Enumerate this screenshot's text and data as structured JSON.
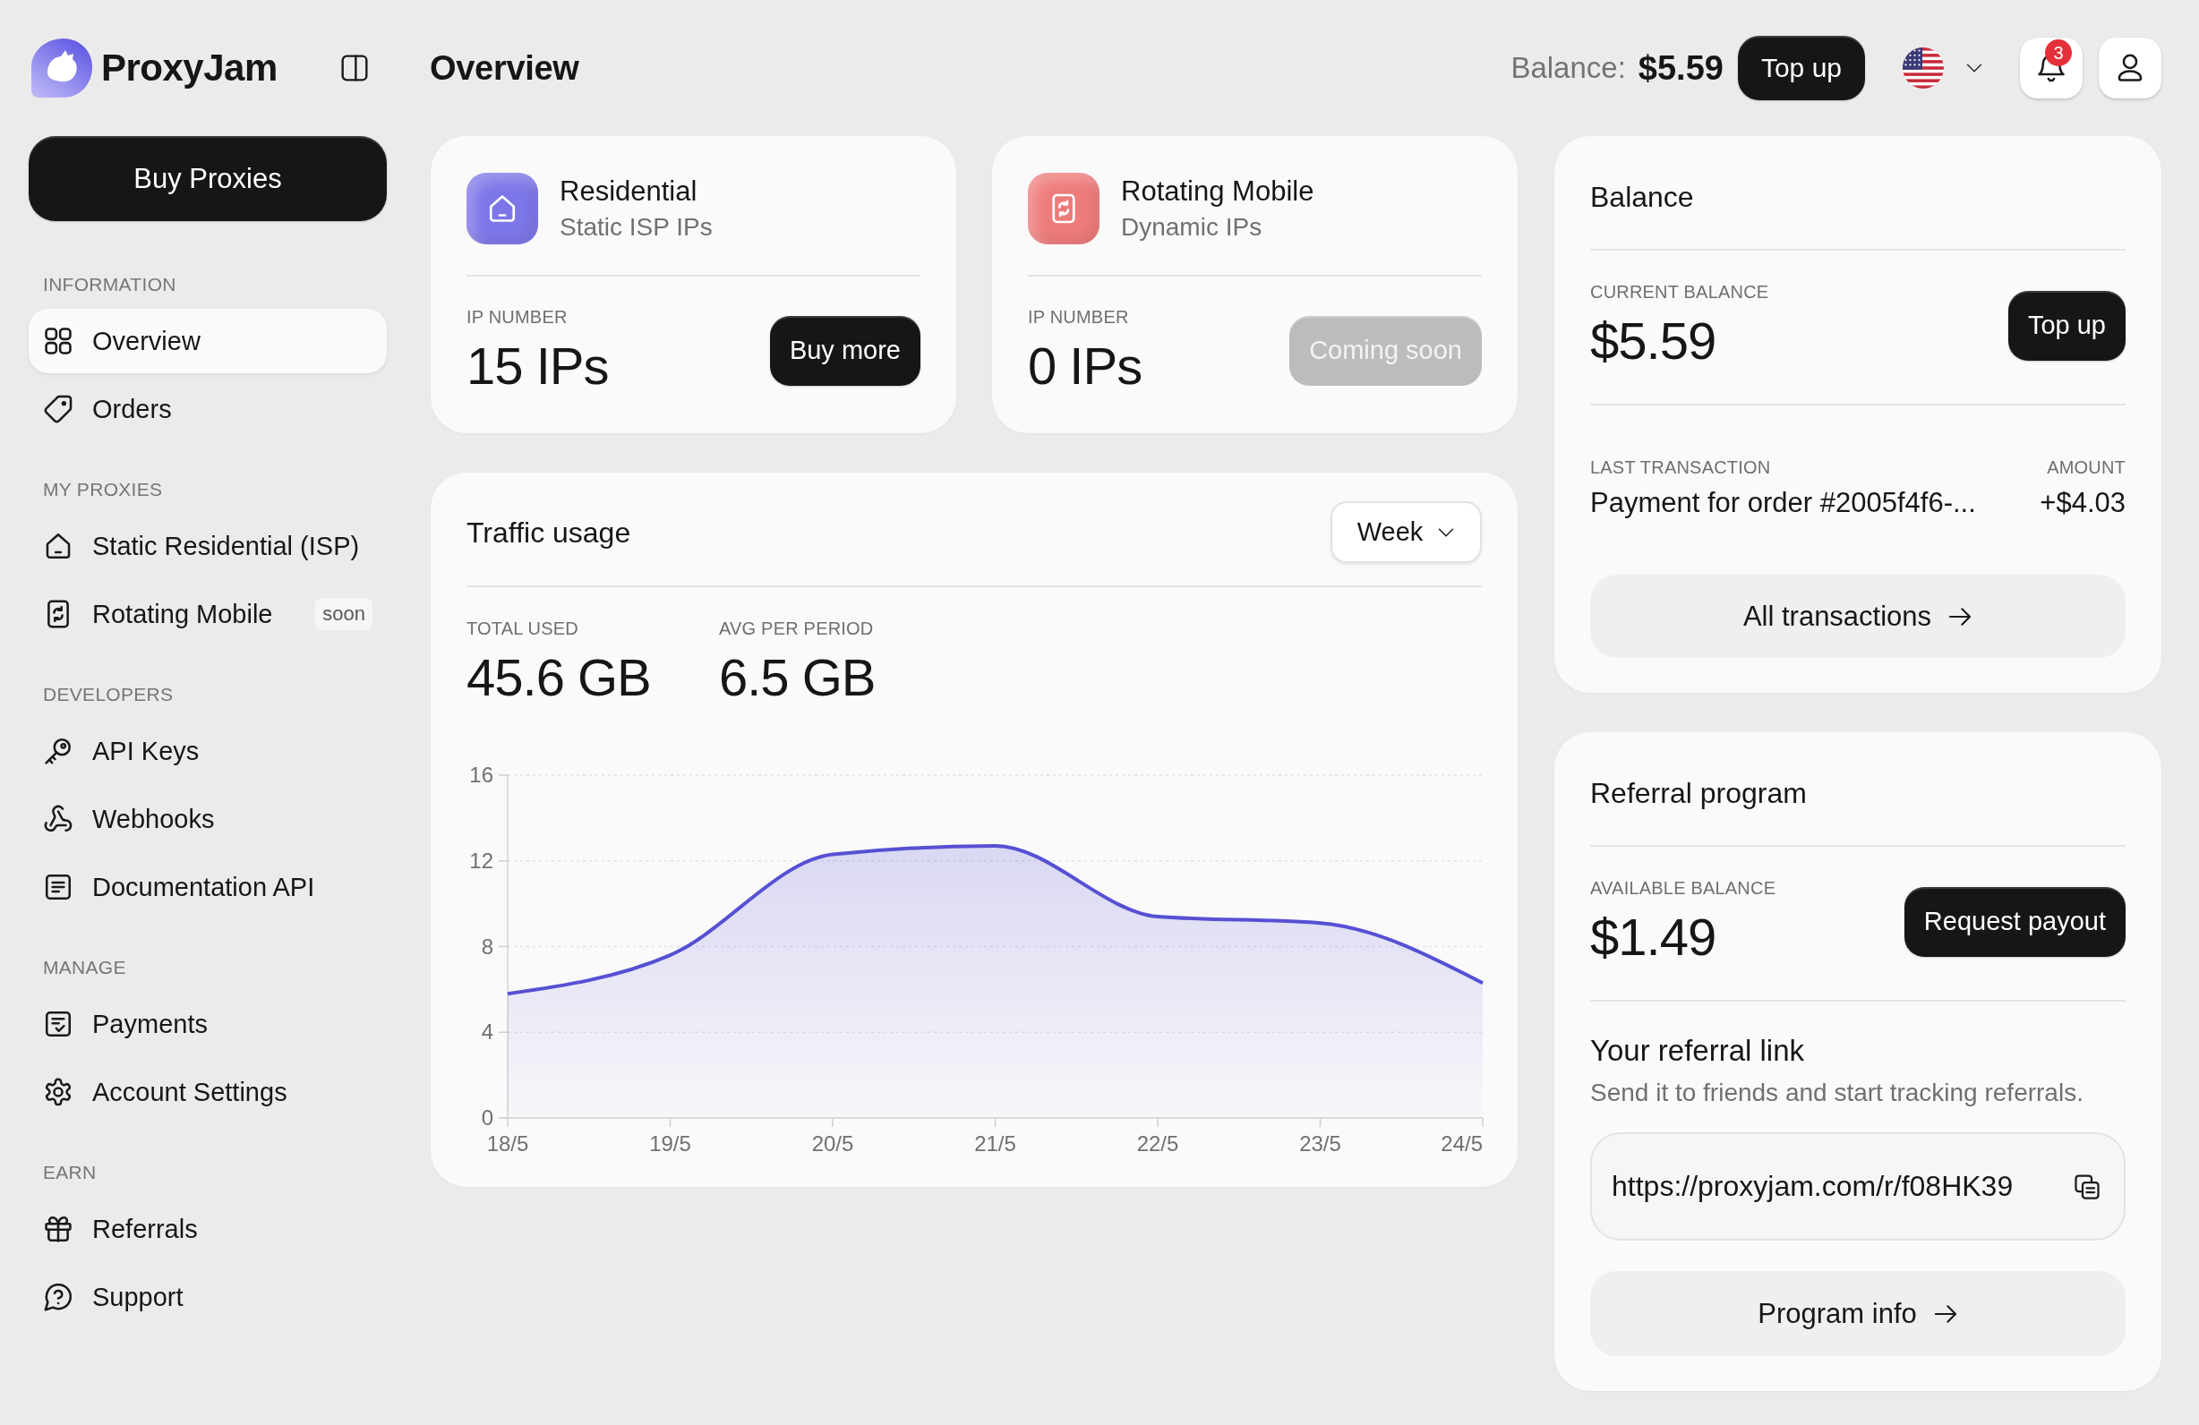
{
  "brand": {
    "name": "ProxyJam"
  },
  "header": {
    "title": "Overview",
    "balance_label": "Balance:",
    "balance_value": "$5.59",
    "top_up_button": "Top up",
    "notifications_count": "3"
  },
  "sidebar": {
    "primary_button": "Buy Proxies",
    "sections": [
      {
        "heading": "INFORMATION",
        "items": [
          {
            "label": "Overview",
            "selected": true
          },
          {
            "label": "Orders",
            "selected": false
          }
        ]
      },
      {
        "heading": "MY PROXIES",
        "items": [
          {
            "label": "Static Residential (ISP)",
            "selected": false
          },
          {
            "label": "Rotating Mobile",
            "selected": false,
            "badge": "soon"
          }
        ]
      },
      {
        "heading": "DEVELOPERS",
        "items": [
          {
            "label": "API Keys",
            "selected": false
          },
          {
            "label": "Webhooks",
            "selected": false
          },
          {
            "label": "Documentation API",
            "selected": false
          }
        ]
      },
      {
        "heading": "MANAGE",
        "items": [
          {
            "label": "Payments",
            "selected": false
          },
          {
            "label": "Account Settings",
            "selected": false
          }
        ]
      },
      {
        "heading": "EARN",
        "items": [
          {
            "label": "Referrals",
            "selected": false
          },
          {
            "label": "Support",
            "selected": false
          }
        ]
      }
    ]
  },
  "products": [
    {
      "title": "Residential",
      "subtitle": "Static ISP IPs",
      "color": "#7d76e8",
      "metric_label": "IP NUMBER",
      "metric_value": "15 IPs",
      "button": {
        "label": "Buy more",
        "disabled": false
      }
    },
    {
      "title": "Rotating Mobile",
      "subtitle": "Dynamic IPs",
      "color": "#ee7b7b",
      "metric_label": "IP NUMBER",
      "metric_value": "0 IPs",
      "button": {
        "label": "Coming soon",
        "disabled": true
      }
    }
  ],
  "traffic": {
    "title": "Traffic usage",
    "period": "Week",
    "stats": [
      {
        "label": "TOTAL USED",
        "value": "45.6 GB"
      },
      {
        "label": "AVG PER PERIOD",
        "value": "6.5 GB"
      }
    ],
    "chart_data": {
      "type": "area",
      "categories": [
        "18/5",
        "19/5",
        "20/5",
        "21/5",
        "22/5",
        "23/5",
        "24/5"
      ],
      "series": [
        {
          "color": "#5650d4",
          "values": [
            5.8,
            7.6,
            12.3,
            12.7,
            9.4,
            9.1,
            6.3
          ]
        }
      ],
      "ylim": [
        0,
        16
      ],
      "yticks": [
        0,
        4,
        8,
        12,
        16
      ],
      "grid": true
    }
  },
  "balance": {
    "title": "Balance",
    "current_label": "CURRENT BALANCE",
    "current_value": "$5.59",
    "top_up_button": "Top up",
    "last_transaction_label": "LAST TRANSACTION",
    "amount_label": "AMOUNT",
    "last_transaction": "Payment for order #2005f4f6-...",
    "amount": "+$4.03",
    "all_button": "All transactions"
  },
  "referral": {
    "title": "Referral program",
    "available_label": "AVAILABLE BALANCE",
    "available_value": "$1.49",
    "payout_button": "Request payout",
    "link_title": "Your referral link",
    "link_hint": "Send it to friends and start tracking referrals.",
    "link": "https://proxyjam.com/r/f08HK39",
    "info_button": "Program info"
  }
}
